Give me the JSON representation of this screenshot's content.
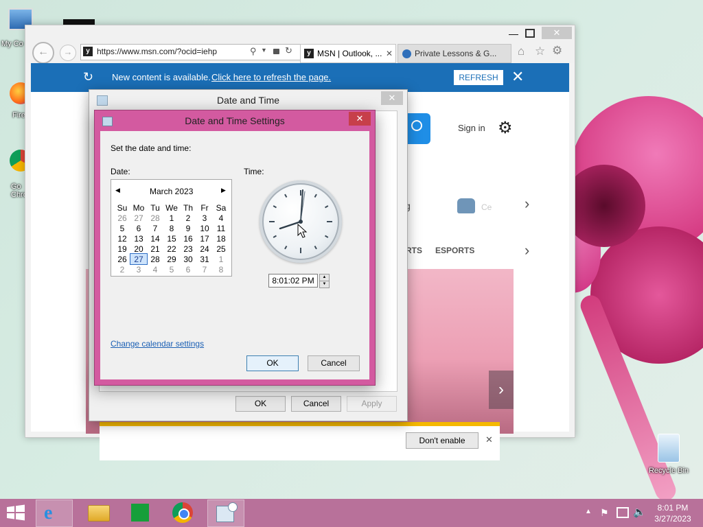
{
  "desktop": {
    "icons": [
      {
        "label": "My Co"
      },
      {
        "label": "Fire"
      },
      {
        "label": "Go Chro"
      },
      {
        "label": "Recycle Bin"
      }
    ]
  },
  "browser": {
    "address": "https://www.msn.com/?ocid=iehp",
    "tabs": [
      {
        "label": "MSN | Outlook, ..."
      },
      {
        "label": "Private Lessons & G..."
      }
    ],
    "notification": {
      "text": "New content is available.",
      "link": "Click here to refresh the page.",
      "refresh_label": "REFRESH"
    },
    "page": {
      "sign_in": "Sign in",
      "nav_items": [
        "RTS",
        "ESPORTS"
      ],
      "partial_text": "g",
      "partial_text2": "Ce",
      "partial_e": "e"
    },
    "prompt": {
      "dont_enable": "Don't enable"
    }
  },
  "date_time_dialog": {
    "title": "Date and Time",
    "ok": "OK",
    "cancel": "Cancel",
    "apply": "Apply"
  },
  "settings_dialog": {
    "title": "Date and Time Settings",
    "instruction": "Set the date and time:",
    "date_label": "Date:",
    "time_label": "Time:",
    "calendar": {
      "month": "March 2023",
      "weekdays": [
        "Su",
        "Mo",
        "Tu",
        "We",
        "Th",
        "Fr",
        "Sa"
      ],
      "weeks": [
        [
          "26",
          "27",
          "28",
          "1",
          "2",
          "3",
          "4"
        ],
        [
          "5",
          "6",
          "7",
          "8",
          "9",
          "10",
          "11"
        ],
        [
          "12",
          "13",
          "14",
          "15",
          "16",
          "17",
          "18"
        ],
        [
          "19",
          "20",
          "21",
          "22",
          "23",
          "24",
          "25"
        ],
        [
          "26",
          "27",
          "28",
          "29",
          "30",
          "31",
          "1"
        ],
        [
          "2",
          "3",
          "4",
          "5",
          "6",
          "7",
          "8"
        ]
      ],
      "selected": "27"
    },
    "time_value": "8:01:02 PM",
    "change_calendar_link": "Change calendar settings",
    "ok": "OK",
    "cancel": "Cancel"
  },
  "taskbar": {
    "time": "8:01 PM",
    "date": "3/27/2023"
  },
  "colors": {
    "ie_accent": "#1b6fb7",
    "dialog_frame": "#d35aa0",
    "taskbar": "#b8719a",
    "link": "#1a5fb4"
  }
}
